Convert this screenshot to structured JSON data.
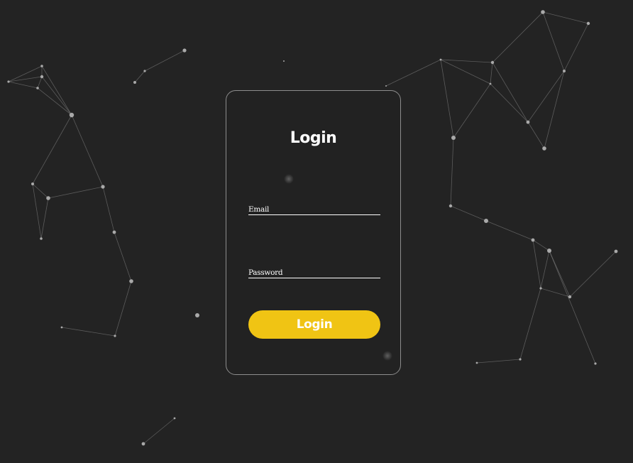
{
  "page": {
    "background_color": "#232323",
    "accent_color": "#f0c414"
  },
  "login_card": {
    "title": "Login",
    "email_label": "Email",
    "password_label": "Password",
    "submit_label": "Login"
  }
}
